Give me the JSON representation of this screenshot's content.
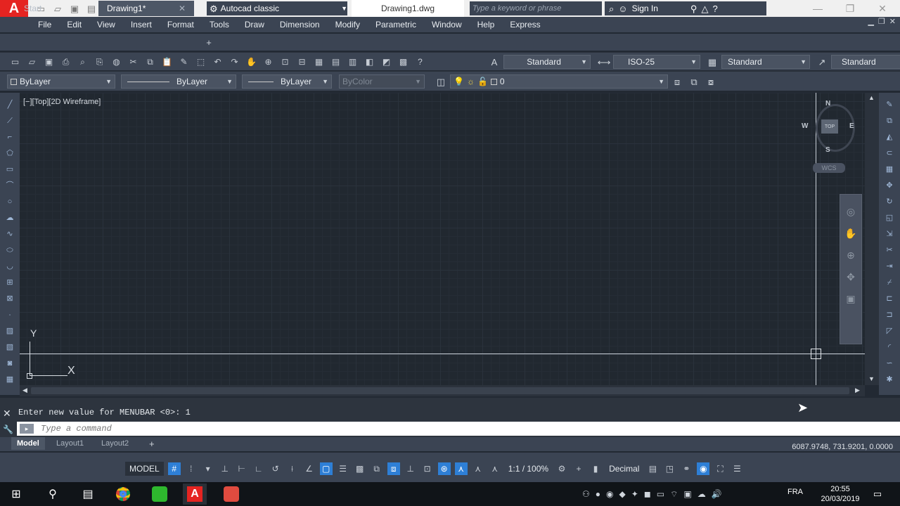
{
  "titlebar": {
    "workspace": "Autocad classic",
    "document_title": "Drawing1.dwg",
    "search_placeholder": "Type a keyword or phrase",
    "sign_in": "Sign In"
  },
  "menubar": {
    "items": [
      "File",
      "Edit",
      "View",
      "Insert",
      "Format",
      "Tools",
      "Draw",
      "Dimension",
      "Modify",
      "Parametric",
      "Window",
      "Help",
      "Express"
    ]
  },
  "tabs": {
    "start": "Start",
    "drawing": "Drawing1*"
  },
  "toolbar1": {
    "text_style": "Standard",
    "dim_style": "ISO-25",
    "table_style": "Standard",
    "multileader_style": "Standard"
  },
  "toolbar2": {
    "color": "ByLayer",
    "linetype": "ByLayer",
    "lineweight": "ByLayer",
    "plotstyle": "ByColor",
    "layer": "0"
  },
  "viewport": {
    "label": "[−][Top][2D Wireframe]",
    "ucs_x": "X",
    "ucs_y": "Y",
    "viewcube": {
      "n": "N",
      "s": "S",
      "e": "E",
      "w": "W",
      "top": "TOP",
      "wcs": "WCS"
    }
  },
  "commandline": {
    "history": "Enter new value for MENUBAR <0>: 1",
    "placeholder": "Type a command"
  },
  "layouts": {
    "tabs": [
      "Model",
      "Layout1",
      "Layout2"
    ]
  },
  "statusbar": {
    "coordinates": "6087.9748, 731.9201, 0.0000",
    "model": "MODEL",
    "scale": "1:1 / 100%",
    "units": "Decimal"
  },
  "taskbar": {
    "time": "20:55",
    "date": "20/03/2019",
    "language": "FRA"
  }
}
